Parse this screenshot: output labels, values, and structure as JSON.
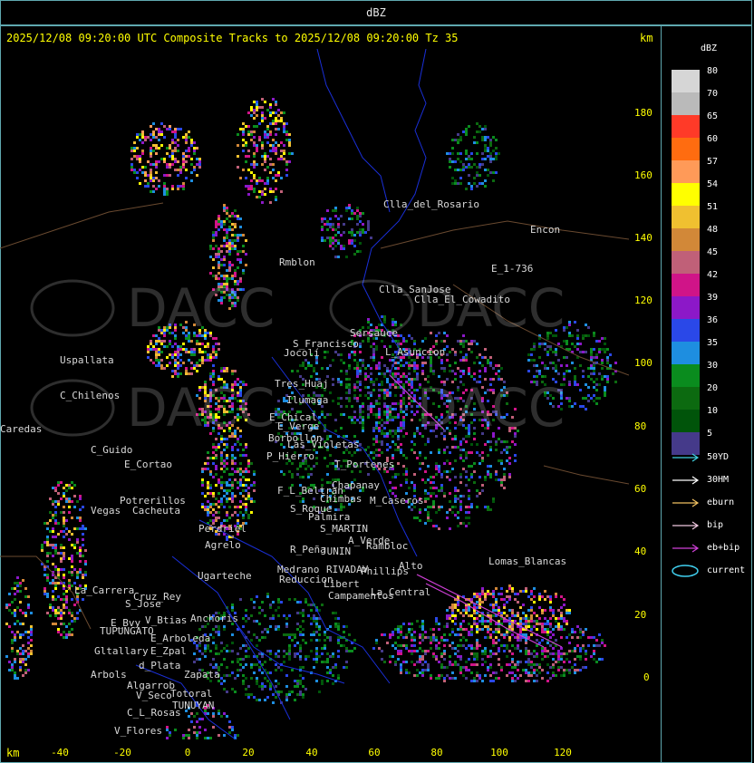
{
  "window": {
    "title": "dBZ"
  },
  "map": {
    "composite_title": "2025/12/08 09:20:00 UTC Composite Tracks to 2025/12/08 09:20:00 Tz 35",
    "unit_top": "km",
    "unit_bottom": "km",
    "y_ticks": [
      "180",
      "160",
      "140",
      "120",
      "100",
      "80",
      "60",
      "40",
      "20",
      "0"
    ],
    "x_ticks": [
      "-40",
      "-20",
      "0",
      "20",
      "40",
      "60",
      "80",
      "100",
      "120"
    ],
    "places": [
      "Clla_del_Rosario",
      "Encon",
      "Rmblon",
      "E_1-736",
      "Clla_SanJose",
      "Clla_El_Cowadito",
      "Uspallata",
      "C_Chilenos",
      "Caredas",
      "C_Guido",
      "E_Cortao",
      "Potrerillos",
      "Vegas",
      "Cacheuta",
      "Perdriel",
      "Agrelo",
      "Ugarteche",
      "La_Carrera",
      "Cruz_Rey",
      "S_Jose",
      "Anchoris",
      "E_Bvy",
      "V_Btias",
      "TUPUNGATO",
      "E_Arboleda",
      "Gltallary",
      "E_Zpal",
      "d_Plata",
      "Arbols",
      "Zapata",
      "Algarrob",
      "V_Seco",
      "Totoral",
      "TUNUYAN",
      "C_L_Rosas",
      "V_Flores",
      "Tres_Huaj",
      "Jocolí",
      "S_Francisco",
      "Ilumaga",
      "E_Chical",
      "E_Verge",
      "Borbollon",
      "Las_Violetas",
      "P_Hierro",
      "F_L_Beltran",
      "Chimbas",
      "S_Roque",
      "Palmira",
      "S_MARTIN",
      "Chapanay",
      "M_Caseros",
      "A_Verde",
      "Rambloc",
      "R_Peña",
      "JUNIN",
      "Medrano",
      "RIVADAV",
      "Phillips",
      "Reduccion",
      "Alto",
      "La_Central",
      "Campamentos",
      "Libert",
      "Lomas_Blancas",
      "T_Portenes",
      "L_Asuncion",
      "Sersauce"
    ]
  },
  "legend": {
    "title": "dBZ",
    "scale": [
      {
        "label": "80",
        "color": "#d6d6d6"
      },
      {
        "label": "70",
        "color": "#bababa"
      },
      {
        "label": "65",
        "color": "#ff3a28"
      },
      {
        "label": "60",
        "color": "#ff6c10"
      },
      {
        "label": "57",
        "color": "#ff9a58"
      },
      {
        "label": "54",
        "color": "#ffff00"
      },
      {
        "label": "51",
        "color": "#f0c030"
      },
      {
        "label": "48",
        "color": "#d28838"
      },
      {
        "label": "45",
        "color": "#c06078"
      },
      {
        "label": "42",
        "color": "#d01488"
      },
      {
        "label": "39",
        "color": "#8c18c8"
      },
      {
        "label": "36",
        "color": "#2a48e8"
      },
      {
        "label": "35",
        "color": "#1e8ee0"
      },
      {
        "label": "30",
        "color": "#0a8c1e"
      },
      {
        "label": "20",
        "color": "#0c6a10"
      },
      {
        "label": "10",
        "color": "#00540a"
      },
      {
        "label": "5",
        "color": "#453a8a"
      }
    ],
    "tracks": [
      {
        "label": "50YD",
        "color": "#40d0e0"
      },
      {
        "label": "30HM",
        "color": "#ffffff"
      },
      {
        "label": "eburn",
        "color": "#f0c060"
      },
      {
        "label": "bip",
        "color": "#f0c8e0"
      },
      {
        "label": "eb+bip",
        "color": "#d040d8"
      },
      {
        "label": "current",
        "color": "#40d0f0"
      }
    ]
  },
  "watermark": {
    "text": "DACC"
  }
}
